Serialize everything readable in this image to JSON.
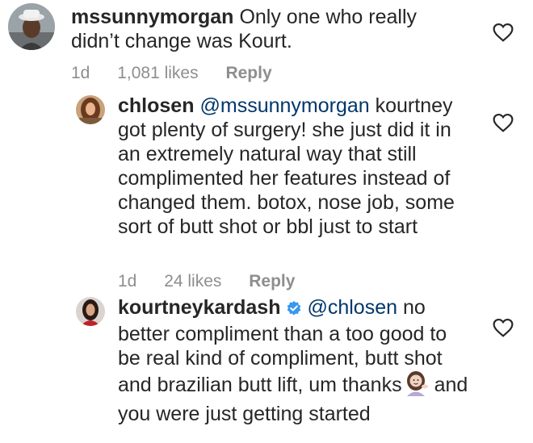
{
  "comments": [
    {
      "username": "mssunnymorgan",
      "text": "Only one who really didn’t change was Kourt.",
      "time": "1d",
      "likes": "1,081 likes",
      "reply_label": "Reply",
      "avatar_icon": "user-avatar-man-hat",
      "like_icon": "heart-outline-icon"
    },
    {
      "username": "chlosen",
      "mention": "@mssunnymorgan",
      "text": "kourtney got plenty of surgery! she just did it in an extremely natural way that still complimented her features instead of changed them. botox, nose job, some sort of butt shot or bbl just to start",
      "time": "1d",
      "likes": "24 likes",
      "reply_label": "Reply",
      "avatar_icon": "user-avatar-woman",
      "like_icon": "heart-outline-icon"
    },
    {
      "username": "kourtneykardash",
      "verified": true,
      "mention": "@chlosen",
      "text_before_emoji": "no better compliment than a too good to be real kind of compliment, butt shot and brazilian butt lift, um thanks",
      "emoji": "woman-tipping-hand-emoji",
      "text_after_emoji": "and you were just getting started",
      "avatar_icon": "user-avatar-woman-red",
      "like_icon": "heart-outline-icon"
    }
  ],
  "colors": {
    "text": "#262626",
    "mention": "#00376b",
    "meta": "#8e8e8e",
    "verified": "#3897f0"
  }
}
